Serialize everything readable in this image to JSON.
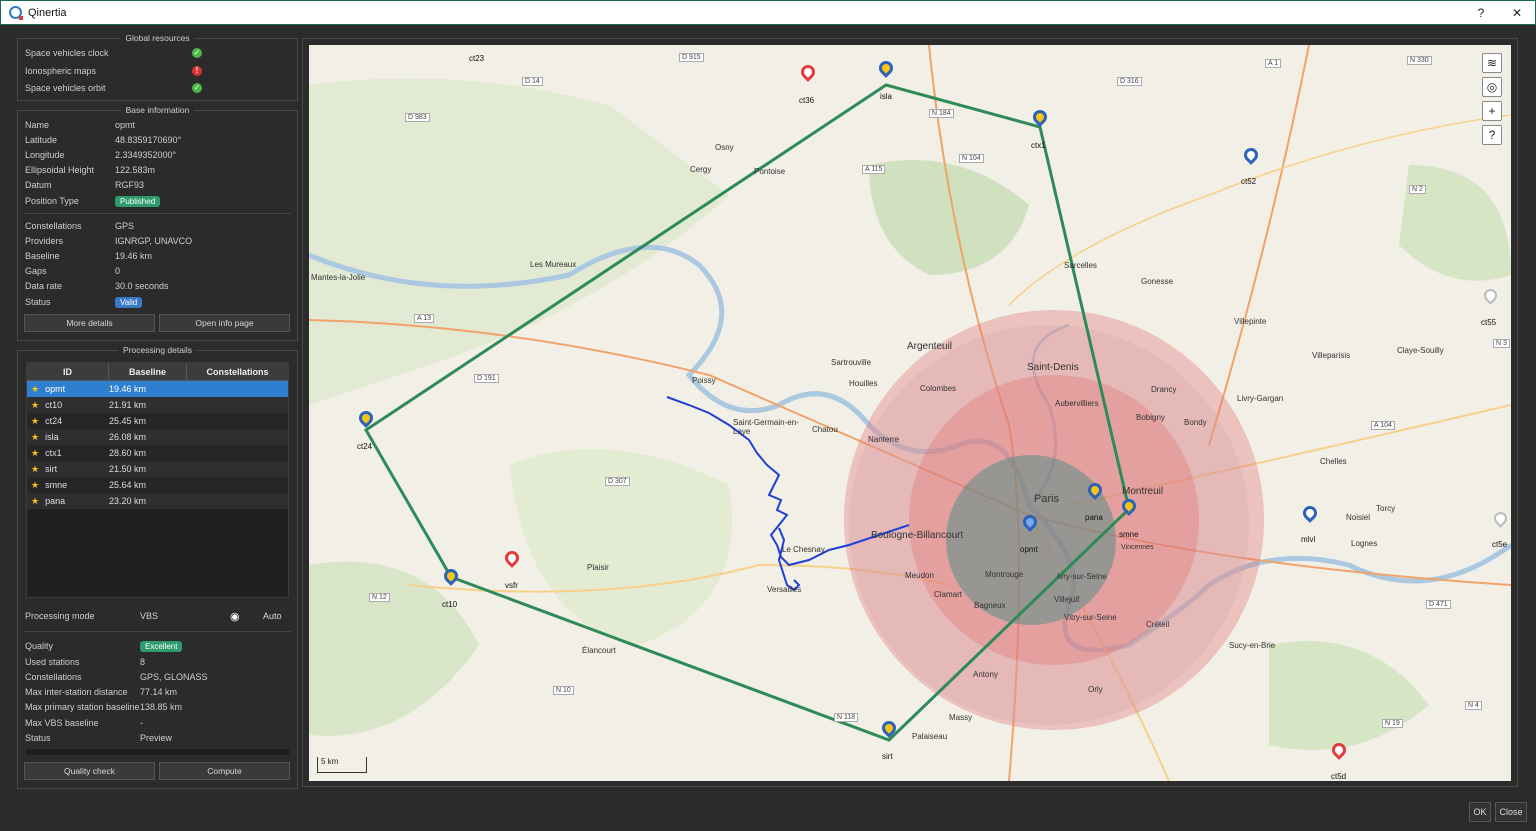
{
  "window": {
    "title": "Qinertia",
    "help": "?",
    "close": "✕"
  },
  "global_resources": {
    "title": "Global resources",
    "items": [
      {
        "label": "Space vehicles clock",
        "status": "ok"
      },
      {
        "label": "Ionospheric maps",
        "status": "error"
      },
      {
        "label": "Space vehicles orbit",
        "status": "ok"
      }
    ]
  },
  "base_info": {
    "title": "Base information",
    "name_k": "Name",
    "name_v": "opmt",
    "lat_k": "Latitude",
    "lat_v": "48.8359170690°",
    "lon_k": "Longitude",
    "lon_v": "2.3349352000°",
    "height_k": "Ellipsoidal Height",
    "height_v": "122.583m",
    "datum_k": "Datum",
    "datum_v": "RGF93",
    "ptype_k": "Position Type",
    "ptype_v": "Published",
    "const_k": "Constellations",
    "const_v": "GPS",
    "prov_k": "Providers",
    "prov_v": "IGNRGP, UNAVCO",
    "base_k": "Baseline",
    "base_v": "19.46 km",
    "gaps_k": "Gaps",
    "gaps_v": "0",
    "rate_k": "Data rate",
    "rate_v": "30.0 seconds",
    "status_k": "Status",
    "status_v": "Valid",
    "more_details": "More details",
    "open_info": "Open info page"
  },
  "processing": {
    "title": "Processing details",
    "columns": [
      "ID",
      "Baseline",
      "Constellations"
    ],
    "rows": [
      {
        "id": "opmt",
        "baseline": "19.46 km"
      },
      {
        "id": "ct10",
        "baseline": "21.91 km"
      },
      {
        "id": "ct24",
        "baseline": "25.45 km"
      },
      {
        "id": "isla",
        "baseline": "26.08 km"
      },
      {
        "id": "ctx1",
        "baseline": "28.60 km"
      },
      {
        "id": "sirt",
        "baseline": "21.50 km"
      },
      {
        "id": "smne",
        "baseline": "25.64 km"
      },
      {
        "id": "pana",
        "baseline": "23.20 km"
      }
    ],
    "mode_k": "Processing mode",
    "mode_v": "VBS",
    "mode_auto": "Auto",
    "quality_k": "Quality",
    "quality_v": "Excellent",
    "used_k": "Used stations",
    "used_v": "8",
    "const_k": "Constellations",
    "const_v": "GPS, GLONASS",
    "inter_k": "Max inter-station distance",
    "inter_v": "77.14 km",
    "primary_k": "Max primary station baseline",
    "primary_v": "138.85 km",
    "vbs_k": "Max VBS baseline",
    "vbs_v": "-",
    "status_k": "Status",
    "status_v": "Preview",
    "quality_check": "Quality check",
    "compute": "Compute"
  },
  "map": {
    "scale": "5 km",
    "stations": [
      {
        "id": "ct23"
      },
      {
        "id": "ct36"
      },
      {
        "id": "isla"
      },
      {
        "id": "ctx1"
      },
      {
        "id": "ct52"
      },
      {
        "id": "ct24"
      },
      {
        "id": "ct10"
      },
      {
        "id": "vsfr"
      },
      {
        "id": "opmt"
      },
      {
        "id": "pana"
      },
      {
        "id": "smne"
      },
      {
        "id": "mlvl"
      },
      {
        "id": "ct55"
      },
      {
        "id": "ct5e"
      },
      {
        "id": "sirt"
      },
      {
        "id": "ct5d"
      }
    ],
    "places": [
      "Paris",
      "Saint-Denis",
      "Argenteuil",
      "Boulogne-Billancourt",
      "Versailles",
      "Montreuil",
      "Les Mureaux",
      "Poissy",
      "Chatou",
      "Nanterre",
      "Colombes",
      "Clamart",
      "Créteil",
      "Sartrouville",
      "Houilles",
      "Massy",
      "Vincennes",
      "Gonesse",
      "Villepinte",
      "Antony",
      "Palaiseau",
      "Orly",
      "Saint-Germain-en-Laye",
      "Le Chesnay",
      "Plaisir",
      "Élancourt",
      "Mantes-la-Jolie",
      "Osny",
      "Cergy",
      "Pontoise",
      "Sarcelles",
      "Torcy",
      "Noisiel",
      "Chelles",
      "Lognes",
      "Sucy-en-Brie",
      "Vitry-sur-Seine",
      "Villejuif",
      "Montrouge",
      "Meudon",
      "Bagneux",
      "Ivry-sur-Seine",
      "Bondy",
      "Drancy",
      "Aubervilliers",
      "Bobigny",
      "Livry-Gargan",
      "Villeparisis",
      "Claye-Souilly"
    ],
    "roads": [
      "D 915",
      "D 14",
      "D 316",
      "N 184",
      "N 104",
      "A 115",
      "D 983",
      "A 13",
      "D 191",
      "N 12",
      "D 307",
      "N 10",
      "N 118",
      "N 2",
      "A 104",
      "N 3",
      "D 471",
      "N 19",
      "N 4",
      "A 1",
      "N 330"
    ],
    "buttons": {
      "layers": "≋",
      "locate": "◎",
      "zoom_in": "+",
      "help": "?"
    }
  },
  "footer": {
    "ok": "OK",
    "close": "Close"
  },
  "colors": {
    "polygon": "#2e8b57",
    "track": "#1f3fd6",
    "selected": "#2f7fd1",
    "published": "#2e9a6e",
    "valid": "#3a79c9"
  }
}
